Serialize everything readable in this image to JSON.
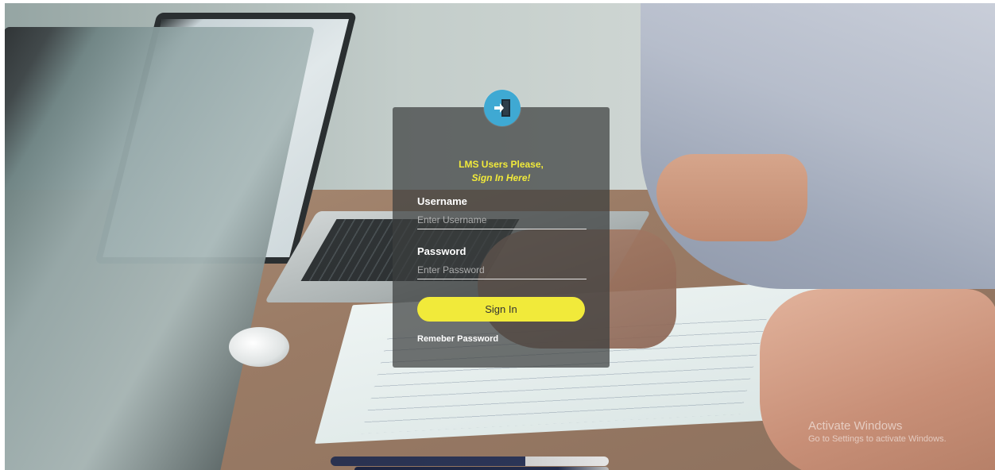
{
  "login": {
    "heading_line1": "LMS Users Please,",
    "heading_line2": "Sign In Here!",
    "username_label": "Username",
    "username_placeholder": "Enter Username",
    "username_value": "",
    "password_label": "Password",
    "password_placeholder": "Enter Password",
    "password_value": "",
    "signin_label": "Sign In",
    "remember_label": "Remeber Password",
    "avatar_icon": "sign-in-door-icon"
  },
  "watermark": {
    "title": "Activate Windows",
    "subtitle": "Go to Settings to activate Windows."
  },
  "colors": {
    "accent_yellow": "#f1ea3a",
    "avatar_blue": "#3fa9d3",
    "card_bg": "rgba(60,62,62,0.72)"
  }
}
